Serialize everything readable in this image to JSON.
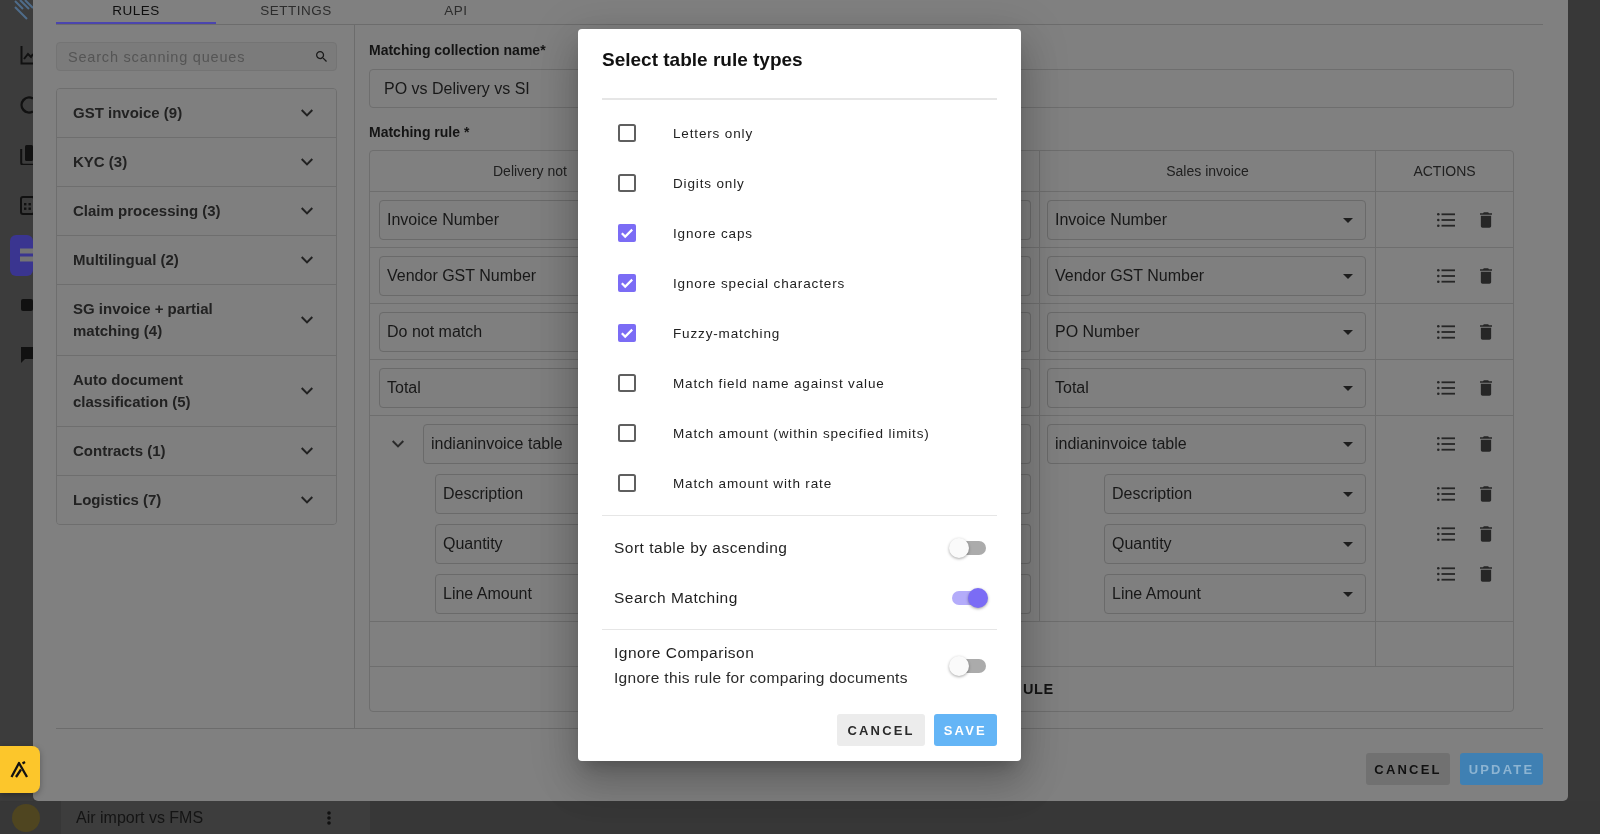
{
  "nav_rail": [
    {
      "selected": false
    },
    {
      "selected": false
    },
    {
      "selected": false
    },
    {
      "selected": false
    },
    {
      "selected": true
    },
    {
      "selected": false
    },
    {
      "selected": false
    }
  ],
  "background_list": {
    "item": "Air import vs FMS"
  },
  "dialog": {
    "tabs": [
      {
        "label": "RULES",
        "selected": true
      },
      {
        "label": "SETTINGS",
        "selected": false
      },
      {
        "label": "API",
        "selected": false
      }
    ],
    "queue_search": {
      "placeholder": "Search scanning queues"
    },
    "queues": [
      "GST invoice (9)",
      "KYC (3)",
      "Claim processing (3)",
      "Multilingual (2)",
      "SG invoice + partial matching (4)",
      "Auto document classification (5)",
      "Contracts (1)",
      "Logistics (7)"
    ],
    "collection_name": {
      "label": "Matching collection name*",
      "value": "PO vs Delivery vs SI"
    },
    "matching_rule": {
      "label": "Matching rule *",
      "columns": [
        "Delivery not",
        "Sales invoice",
        "ACTIONS"
      ],
      "rows": [
        {
          "kind": "field",
          "cells": [
            "Invoice Number",
            "Invoice Number"
          ]
        },
        {
          "kind": "field",
          "cells": [
            "Vendor GST Number",
            "Vendor GST Number"
          ]
        },
        {
          "kind": "field",
          "cells": [
            "Do not match",
            "PO Number"
          ]
        },
        {
          "kind": "field",
          "cells": [
            "Total",
            "Total"
          ]
        },
        {
          "kind": "table",
          "expanded": true,
          "cells": [
            "indianinvoice table",
            "indianinvoice table"
          ],
          "children": [
            {
              "cells": [
                "Description",
                "Description"
              ]
            },
            {
              "cells": [
                "Quantity",
                "Quantity"
              ]
            },
            {
              "cells": [
                "Line Amount",
                "Line Amount"
              ]
            }
          ]
        }
      ],
      "add_rule": "ULE"
    },
    "buttons": [
      {
        "label": "CANCEL",
        "kind": "secondary"
      },
      {
        "label": "UPDATE",
        "kind": "primary"
      }
    ]
  },
  "rule_types_modal": {
    "title": "Select table rule types",
    "options": [
      {
        "label": "Letters only",
        "checked": false
      },
      {
        "label": "Digits only",
        "checked": false
      },
      {
        "label": "Ignore caps",
        "checked": true
      },
      {
        "label": "Ignore special characters",
        "checked": true
      },
      {
        "label": "Fuzzy-matching",
        "checked": true
      },
      {
        "label": "Match field name against value",
        "checked": false
      },
      {
        "label": "Match amount (within specified limits)",
        "checked": false
      },
      {
        "label": "Match amount with rate",
        "checked": false
      }
    ],
    "toggles": [
      {
        "label": "Sort table by ascending",
        "on": false
      },
      {
        "label": "Search Matching",
        "on": true
      }
    ],
    "ignore": {
      "label": "Ignore Comparison",
      "description": "Ignore this rule for comparing documents",
      "on": false
    },
    "buttons": [
      {
        "label": "CANCEL",
        "kind": "secondary"
      },
      {
        "label": "SAVE",
        "kind": "primary"
      }
    ]
  }
}
